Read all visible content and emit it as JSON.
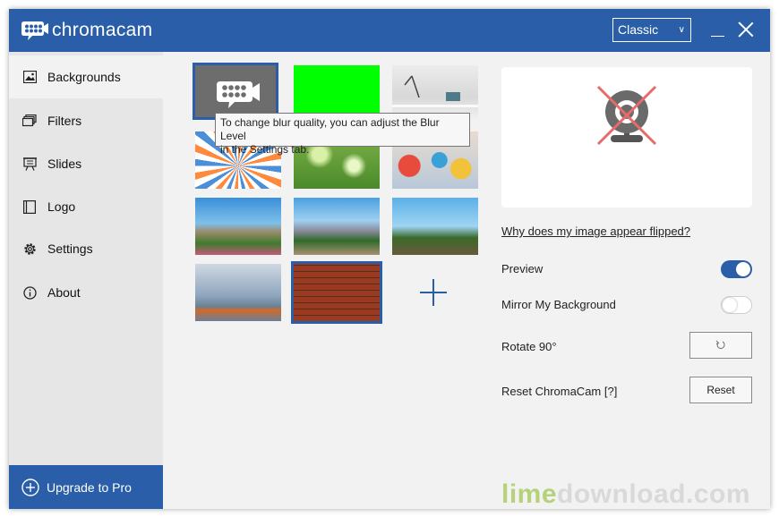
{
  "app": {
    "name": "chromacam"
  },
  "titlebar": {
    "mode_select": "Classic"
  },
  "sidebar": {
    "items": [
      {
        "label": "Backgrounds",
        "icon": "image-icon",
        "active": true
      },
      {
        "label": "Filters",
        "icon": "layers-icon"
      },
      {
        "label": "Slides",
        "icon": "slides-icon"
      },
      {
        "label": "Logo",
        "icon": "logo-icon"
      },
      {
        "label": "Settings",
        "icon": "gear-icon"
      },
      {
        "label": "About",
        "icon": "info-icon"
      }
    ],
    "upgrade_label": "Upgrade to Pro"
  },
  "backgrounds": {
    "thumbnails": [
      {
        "id": "chromacam-logo",
        "selected": true
      },
      {
        "id": "green-screen"
      },
      {
        "id": "office-desk"
      },
      {
        "id": "sunburst"
      },
      {
        "id": "bokeh-green"
      },
      {
        "id": "chat-bubbles"
      },
      {
        "id": "palm-road"
      },
      {
        "id": "desert-mountains"
      },
      {
        "id": "ferris-wheel"
      },
      {
        "id": "lounge-room"
      },
      {
        "id": "brick-wall",
        "selected": true
      }
    ],
    "add_icon": "plus-icon",
    "tooltip": {
      "line1": "To change blur quality, you can adjust the Blur Level",
      "line2": "in the Settings tab."
    }
  },
  "right_panel": {
    "preview_icon": "webcam-disabled-icon",
    "flip_link": "Why does my image appear flipped?",
    "preview_label": "Preview",
    "preview_on": true,
    "mirror_label": "Mirror My Background",
    "mirror_on": false,
    "rotate_label": "Rotate 90°",
    "rotate_icon": "rotate-icon",
    "reset_label": "Reset ChromaCam [?]",
    "reset_button": "Reset"
  },
  "watermark": {
    "part1": "lime",
    "part2": "download.com"
  },
  "colors": {
    "brand": "#2a5ea8",
    "green": "#00ff00"
  }
}
